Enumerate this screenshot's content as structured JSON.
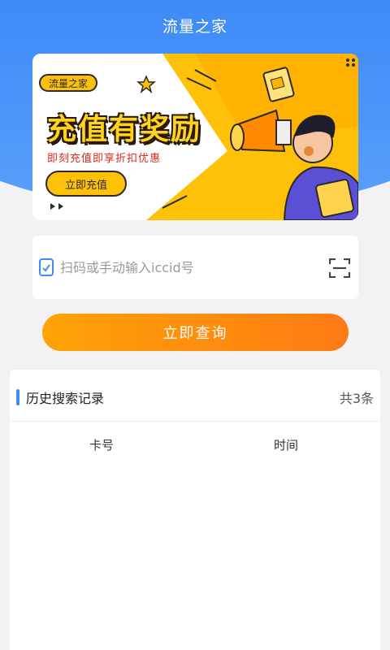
{
  "header": {
    "title": "流量之家"
  },
  "banner": {
    "tag": "流量之家",
    "headline": "充值有奖励",
    "subline": "即刻充值即享折扣优惠",
    "cta_label": "立即充值"
  },
  "search": {
    "placeholder": "扫码或手动输入iccid号",
    "value": ""
  },
  "query_button": {
    "label": "立即查询"
  },
  "history": {
    "title": "历史搜索记录",
    "count_label": "共3条",
    "columns": [
      "卡号",
      "时间"
    ]
  },
  "colors": {
    "primary_blue": "#3f8cf7",
    "accent_orange": "#fd7a14",
    "banner_yellow": "#ffc107"
  },
  "icons": {
    "search_left": "document-check-icon",
    "search_right": "scan-icon"
  }
}
